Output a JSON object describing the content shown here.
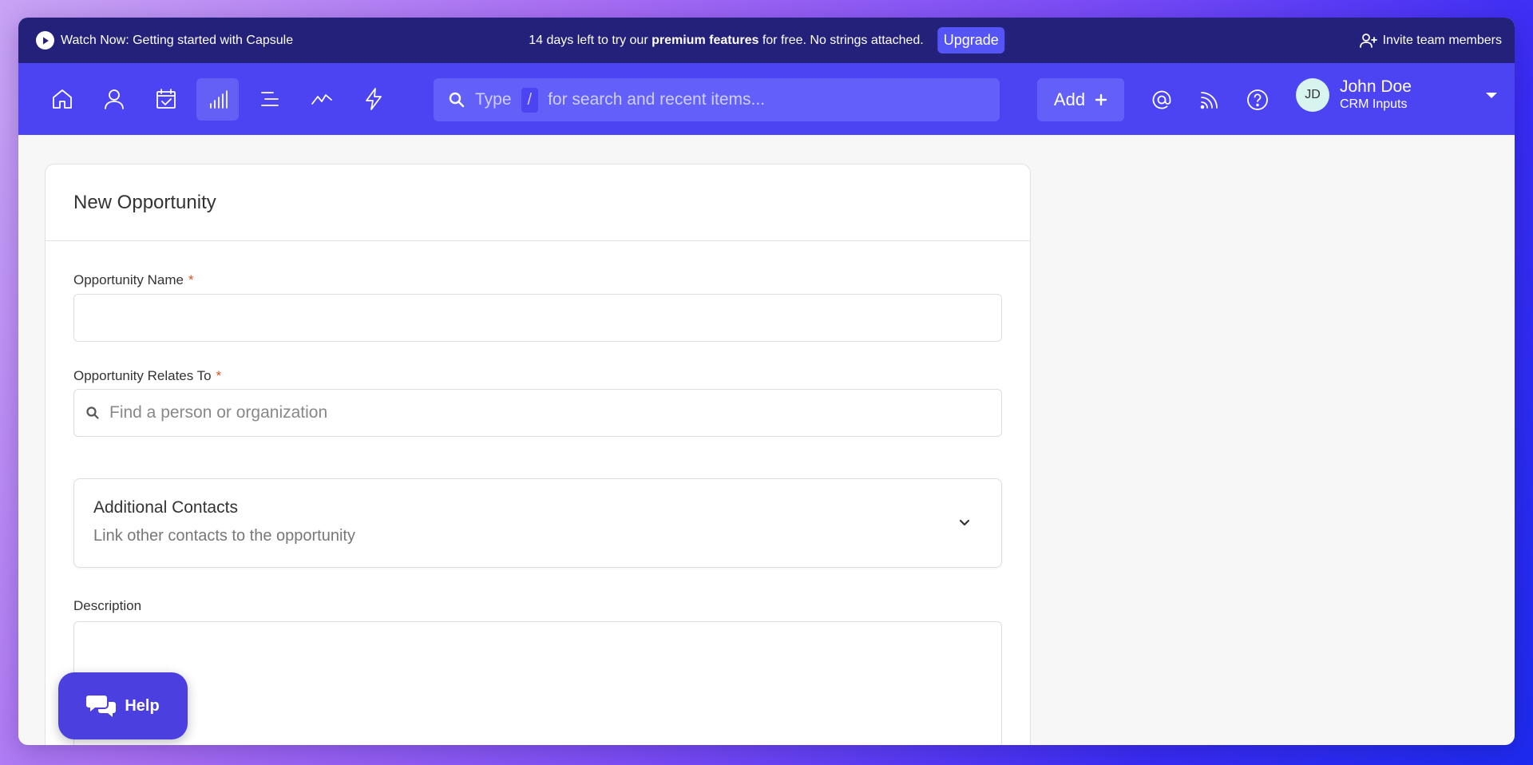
{
  "promo": {
    "watch_label": "Watch Now: Getting started with Capsule",
    "trial_prefix": "14 days left to try our",
    "trial_bold": "premium features",
    "trial_suffix": "for free. No strings attached.",
    "upgrade_label": "Upgrade",
    "invite_label": "Invite team members"
  },
  "nav": {
    "items": [
      "home-icon",
      "person-icon",
      "calendar-check-icon",
      "bar-chart-icon",
      "list-icon",
      "trend-line-icon",
      "lightning-icon"
    ],
    "active": "bar-chart-icon",
    "search": {
      "prefix": "Type",
      "key": "/",
      "suffix": "for search and recent items..."
    },
    "add_label": "Add",
    "right_icons": [
      "at-icon",
      "feed-icon",
      "help-circle-icon"
    ],
    "user": {
      "initials": "JD",
      "name": "John Doe",
      "subtitle": "CRM Inputs"
    }
  },
  "form": {
    "title": "New Opportunity",
    "name_label": "Opportunity Name",
    "relates_label": "Opportunity Relates To",
    "relates_placeholder": "Find a person or organization",
    "required_mark": "*",
    "contacts_title": "Additional Contacts",
    "contacts_subtitle": "Link other contacts to the opportunity",
    "description_label": "Description"
  },
  "help": {
    "label": "Help"
  },
  "colors": {
    "promo_bg": "#23217a",
    "nav_bg": "#4c44f2",
    "accent": "#5555f7",
    "help_bg": "#4b3fe0",
    "required": "#d9531e"
  }
}
